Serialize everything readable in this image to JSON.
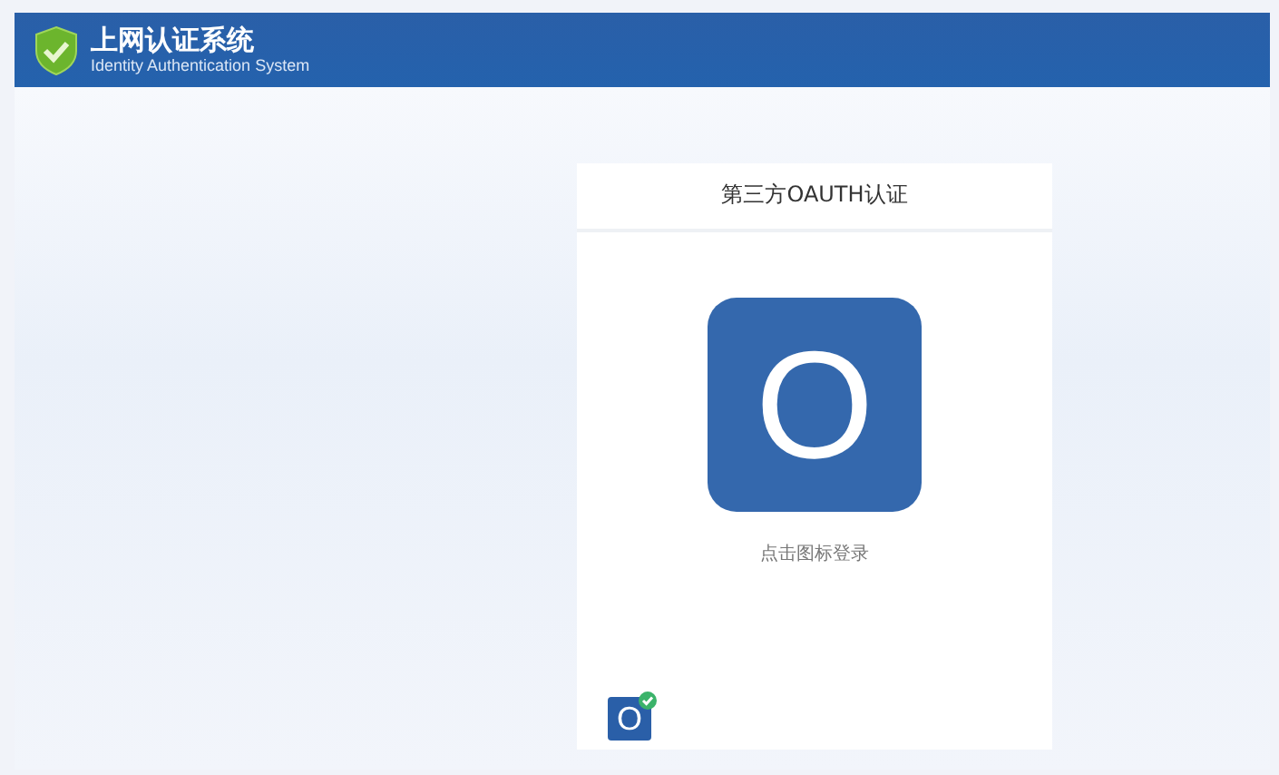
{
  "header": {
    "title": "上网认证系统",
    "subtitle": "Identity Authentication System"
  },
  "card": {
    "title": "第三方OAUTH认证",
    "logo_letter": "O",
    "hint": "点击图标登录",
    "corner_letter": "O"
  }
}
